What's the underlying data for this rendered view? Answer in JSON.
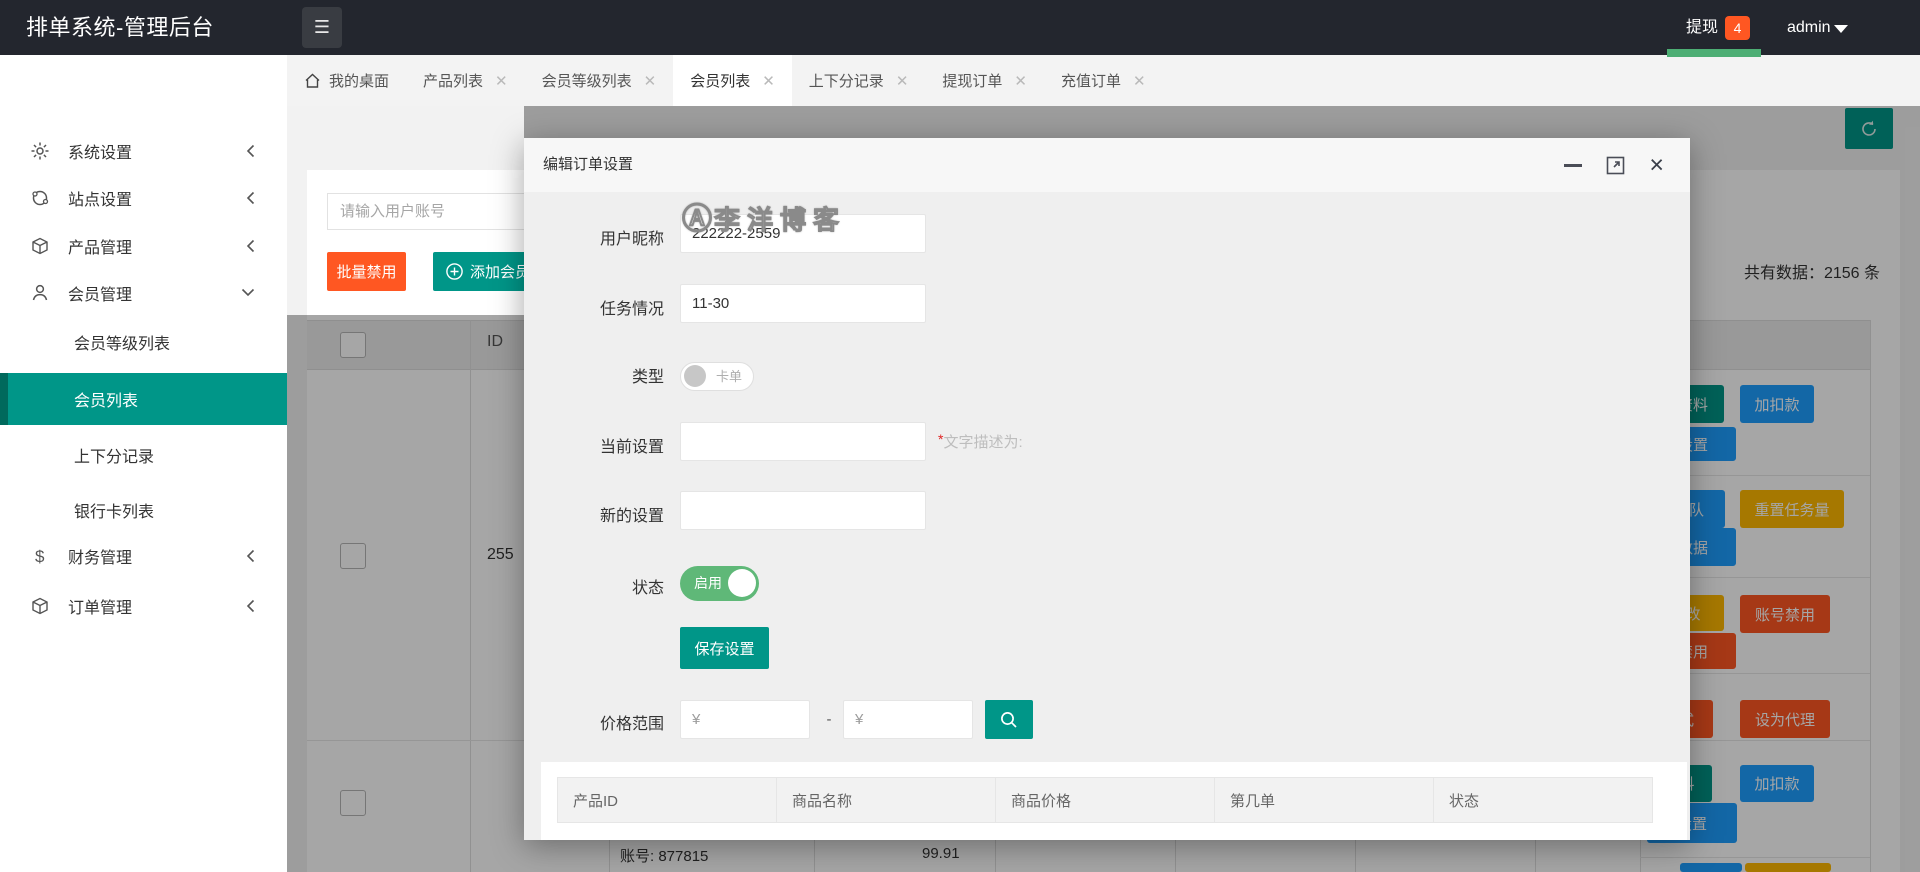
{
  "colors": {
    "teal": "#009688",
    "blue": "#1E9FFF",
    "yellow": "#FFB800",
    "red": "#FF5722",
    "green": "#5FB878",
    "header_bg": "#23262E"
  },
  "header": {
    "title": "排单系统-管理后台",
    "menu_icon": "☰",
    "withdraw_label": "提现",
    "withdraw_badge": "4",
    "username": "admin"
  },
  "tabs": [
    {
      "label": "我的桌面",
      "home": true,
      "closable": false,
      "active": false
    },
    {
      "label": "产品列表",
      "home": false,
      "closable": true,
      "active": false
    },
    {
      "label": "会员等级列表",
      "home": false,
      "closable": true,
      "active": false
    },
    {
      "label": "会员列表",
      "home": false,
      "closable": true,
      "active": true
    },
    {
      "label": "上下分记录",
      "home": false,
      "closable": true,
      "active": false
    },
    {
      "label": "提现订单",
      "home": false,
      "closable": true,
      "active": false
    },
    {
      "label": "充值订单",
      "home": false,
      "closable": true,
      "active": false
    }
  ],
  "sidebar": [
    {
      "label": "系统设置",
      "type": "parent",
      "icon": "gear-icon",
      "chevron": "left",
      "active": false
    },
    {
      "label": "站点设置",
      "type": "parent",
      "icon": "site-icon",
      "chevron": "left",
      "active": false
    },
    {
      "label": "产品管理",
      "type": "parent",
      "icon": "product-icon",
      "chevron": "left",
      "active": false
    },
    {
      "label": "会员管理",
      "type": "parent",
      "icon": "member-icon",
      "chevron": "down",
      "active": false
    },
    {
      "label": "会员等级列表",
      "type": "sub",
      "icon": "",
      "chevron": "",
      "active": false
    },
    {
      "label": "会员列表",
      "type": "sub",
      "icon": "",
      "chevron": "",
      "active": true
    },
    {
      "label": "上下分记录",
      "type": "sub",
      "icon": "",
      "chevron": "",
      "active": false
    },
    {
      "label": "银行卡列表",
      "type": "sub",
      "icon": "",
      "chevron": "",
      "active": false
    },
    {
      "label": "财务管理",
      "type": "parent",
      "icon": "finance-icon",
      "chevron": "left",
      "active": false
    },
    {
      "label": "订单管理",
      "type": "parent",
      "icon": "order-icon",
      "chevron": "left",
      "active": false
    }
  ],
  "page": {
    "search_placeholder": "请输入用户账号",
    "batch_disable_label": "批量禁用",
    "add_member_label": "添加会员",
    "total_text": "共有数据：2156 条",
    "id_header": "ID",
    "row_id_fragment": "255",
    "bottom_cells": [
      "账号: 877815",
      "99.91"
    ],
    "actions": [
      {
        "label": "资料",
        "color": "teal"
      },
      {
        "label": "加扣款",
        "color": "blue"
      },
      {
        "label": "设置",
        "color": "blue"
      },
      {
        "label": "队",
        "color": "blue"
      },
      {
        "label": "重置任务量",
        "color": "yellow"
      },
      {
        "label": "数据",
        "color": "blue"
      },
      {
        "label": "改",
        "color": "yellow"
      },
      {
        "label": "账号禁用",
        "color": "red"
      },
      {
        "label": "禁用",
        "color": "red"
      },
      {
        "label": "式",
        "color": "red"
      },
      {
        "label": "设为代理",
        "color": "red"
      },
      {
        "label": "料",
        "color": "teal"
      },
      {
        "label": "加扣款",
        "color": "blue"
      },
      {
        "label": "设置",
        "color": "blue"
      },
      {
        "label": "",
        "color": "blue"
      },
      {
        "label": "",
        "color": "yellow"
      }
    ]
  },
  "modal": {
    "title": "编辑订单设置",
    "watermark_logo": "Ⓐ",
    "watermark_text": "李洋博客",
    "fields": {
      "nickname": {
        "label": "用户昵称",
        "value": "222222-2559"
      },
      "task": {
        "label": "任务情况",
        "value": "11-30"
      },
      "type": {
        "label": "类型",
        "toggle_text": "卡单"
      },
      "current": {
        "label": "当前设置",
        "value": "",
        "hint_star": "*",
        "hint_text": "文字描述为:"
      },
      "new": {
        "label": "新的设置",
        "value": ""
      },
      "status": {
        "label": "状态",
        "toggle_text": "启用"
      },
      "price": {
        "label": "价格范围",
        "placeholder": "¥",
        "separator": "-"
      }
    },
    "save_label": "保存设置",
    "table_headers": [
      "产品ID",
      "商品名称",
      "商品价格",
      "第几单",
      "状态"
    ]
  }
}
